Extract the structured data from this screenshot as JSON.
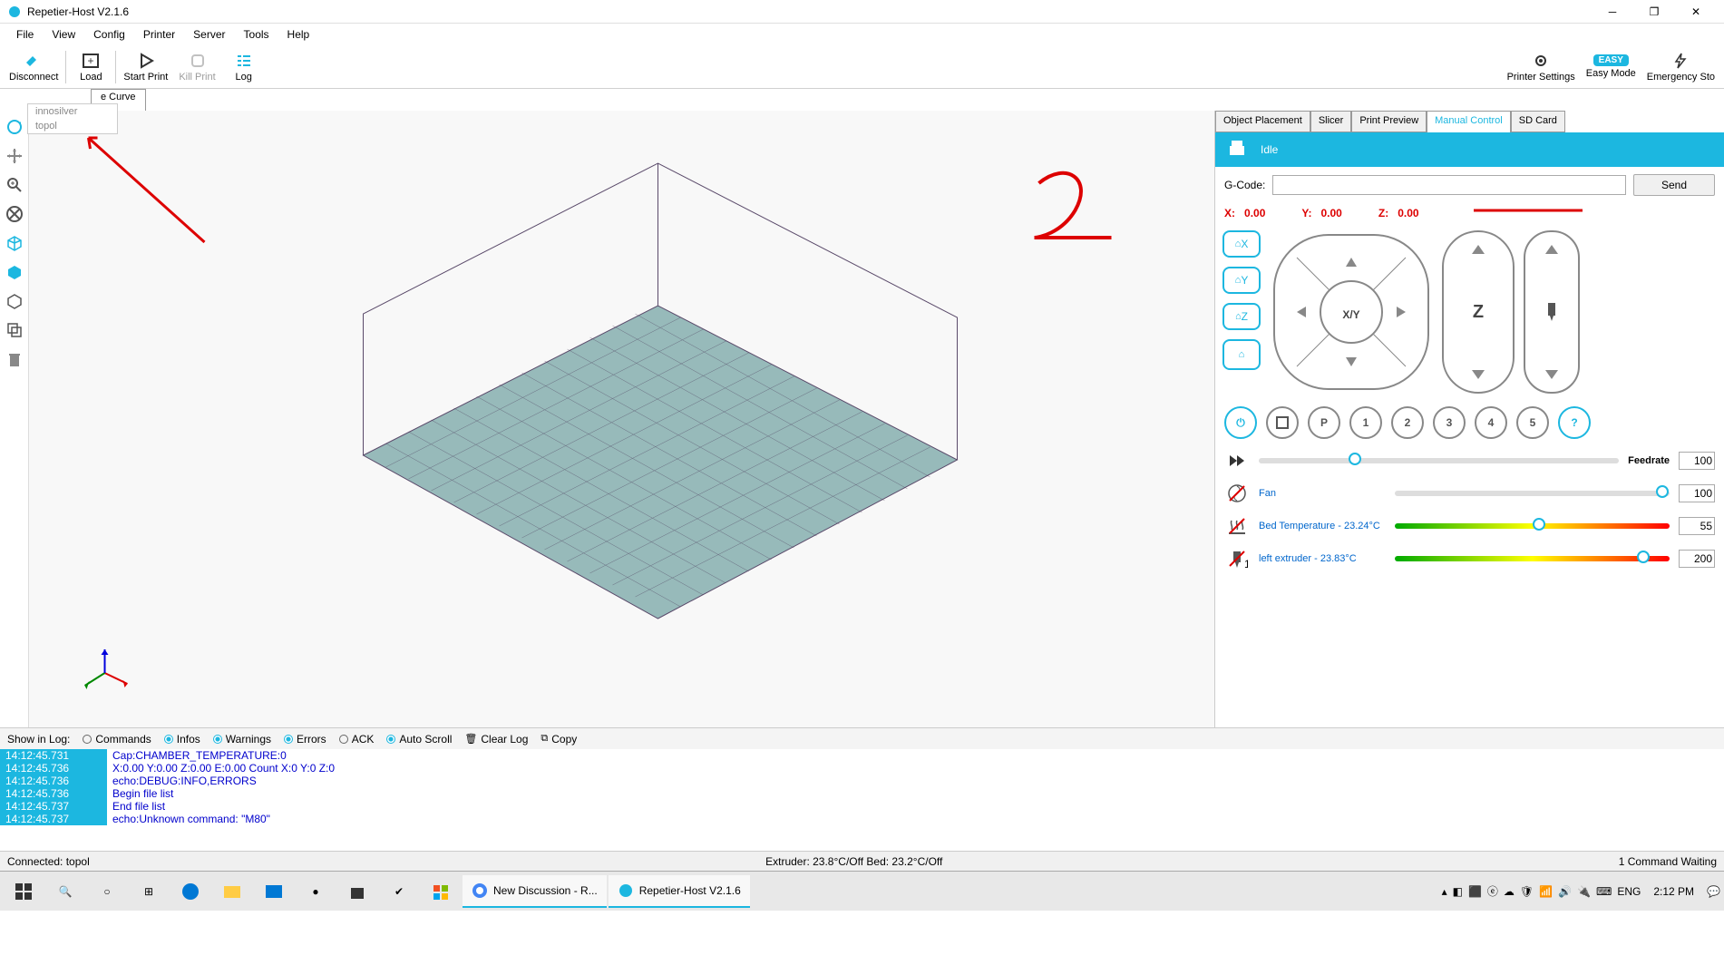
{
  "window": {
    "title": "Repetier-Host V2.1.6"
  },
  "menu": [
    "File",
    "View",
    "Config",
    "Printer",
    "Server",
    "Tools",
    "Help"
  ],
  "toolbar": {
    "disconnect": "Disconnect",
    "load": "Load",
    "start": "Start Print",
    "kill": "Kill Print",
    "log": "Log",
    "settings": "Printer Settings",
    "easy": "Easy Mode",
    "easy_badge": "EASY",
    "emergency": "Emergency Sto"
  },
  "subtab_left": "e Curve",
  "dropdown": [
    "innosilver",
    "topol"
  ],
  "right_tabs": [
    "Object Placement",
    "Slicer",
    "Print Preview",
    "Manual Control",
    "SD Card"
  ],
  "manual": {
    "status": "Idle",
    "gcode_label": "G-Code:",
    "send": "Send",
    "x_label": "X:",
    "x_val": "0.00",
    "y_label": "Y:",
    "y_val": "0.00",
    "z_label": "Z:",
    "z_val": "0.00",
    "home_x": "X",
    "home_y": "Y",
    "home_z": "Z",
    "xy_label": "X/Y",
    "z_pad": "Z",
    "nums": [
      "P",
      "1",
      "2",
      "3",
      "4",
      "5"
    ],
    "feedrate_label": "Feedrate",
    "feedrate_val": "100",
    "fan_label": "Fan",
    "fan_val": "100",
    "bed_label": "Bed Temperature - 23.24°C",
    "bed_val": "55",
    "ext_label": "left extruder - 23.83°C",
    "ext_val": "200"
  },
  "logbar": {
    "show": "Show in Log:",
    "commands": "Commands",
    "infos": "Infos",
    "warnings": "Warnings",
    "errors": "Errors",
    "ack": "ACK",
    "auto": "Auto Scroll",
    "clear": "Clear Log",
    "copy": "Copy"
  },
  "log": [
    {
      "t": "14:12:45.731",
      "m": "Cap:CHAMBER_TEMPERATURE:0"
    },
    {
      "t": "14:12:45.736",
      "m": "X:0.00 Y:0.00 Z:0.00 E:0.00 Count X:0 Y:0 Z:0"
    },
    {
      "t": "14:12:45.736",
      "m": "echo:DEBUG:INFO,ERRORS"
    },
    {
      "t": "14:12:45.736",
      "m": "Begin file list"
    },
    {
      "t": "14:12:45.737",
      "m": "End file list"
    },
    {
      "t": "14:12:45.737",
      "m": "echo:Unknown command: \"M80\""
    }
  ],
  "status": {
    "left": "Connected: topol",
    "mid": "Extruder: 23.8°C/Off Bed: 23.2°C/Off",
    "right": "1 Command Waiting"
  },
  "taskbar": {
    "app1": "New Discussion - R...",
    "app2": "Repetier-Host V2.1.6",
    "lang": "ENG",
    "time": "2:12 PM"
  }
}
